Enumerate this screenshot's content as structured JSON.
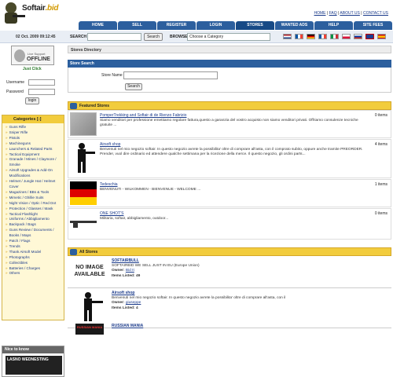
{
  "header": {
    "logo_prefix": "S",
    "logo_main": "oftair",
    "logo_suffix": ".bid",
    "toplinks": [
      "HOME",
      "FAQ",
      "ABOUT US",
      "CONTACT US"
    ],
    "nav": [
      "HOME",
      "SELL",
      "REGISTER",
      "LOGIN",
      "STORES",
      "WANTED ADS",
      "HELP",
      "SITE FEES"
    ],
    "active_nav": "STORES"
  },
  "infobar": {
    "date": "02 Oct. 2009 09:12:45",
    "search_label": "SEARCH",
    "search_button": "Search",
    "browse_label": "BROWSE",
    "browse_value": "Choose a Category",
    "flags": [
      "nl",
      "fr",
      "de",
      "fr2",
      "it",
      "pl",
      "ru",
      "gb",
      "es"
    ]
  },
  "sidebar": {
    "live_support": "Live Support",
    "offline": "OFFLINE",
    "just_click": "Just Click",
    "username_label": "Username",
    "password_label": "Password",
    "login_button": "login",
    "categories_title": "Categories [-]",
    "categories": [
      "Guns Rifle",
      "Sniper Rifle",
      "Pistols",
      "Machineguns",
      "Launchers & Related Parts",
      "Tactical Equipment",
      "Granade / Mines / Claymore / Smoke",
      "Airsoft Upgrades & Add-On Modifications",
      "Helmet / Jungle Hat / Helmet Cover",
      "Magazines / BBs & Tools",
      "Mimetic / Ghillie Suits",
      "Night Vision / Optic / Red Dot",
      "Protection / Glasses / Mask",
      "Tactical Flashlight",
      "Uniforms / Abbigliamento",
      "Backpack / Bags",
      "Guns Review / Documents / Books / Maps",
      "Patch / Flags",
      "Trends",
      "Thank Airsoft Model",
      "Photographs",
      "Collectibles",
      "Batteries / Charges",
      "Others"
    ],
    "nice_title": "Nice to know",
    "nice_banner": "LASNO WEDNESTING"
  },
  "main": {
    "directory_title": "Stores Directory",
    "store_search_title": "Store Search",
    "store_name_label": "Store Name",
    "search_button": "Search",
    "featured_title": "Featured Stores",
    "featured": [
      {
        "name": "PomperTrekking and Softair di de Rienzo Fabrizio",
        "items": "0 items",
        "desc": "Siamo venditori per professione emettiamo regolare fattura,questo a garanzia del vostro acquisto non siamo venditori privati. Offriamo consulenze tecniche gratuite ..."
      },
      {
        "name": "Airsoft shop",
        "items": "4 items",
        "desc": "Benvenuti nel mio negozio softair. In questo negozio avrete la possibilita' oltre di comprare all'asta, con il comprato subito, oppure anche tramite PREORDER. Prender, vuol dire ordinario ed attendere qualche settimana per la ricezione della merce. Il questo negozio, gli ordini parts..."
      },
      {
        "name": "Tedeschia",
        "items": "1 items",
        "desc": "BENVENUTI - WILKOMMEN - BIENVENUE - WELCOME ..."
      },
      {
        "name": "ONE SHOT'S",
        "items": "0 items",
        "desc": "Militaria, softair, abbigliamento, outdoor..."
      }
    ],
    "all_title": "All Stores",
    "all": [
      {
        "name": "SOFTAIRBULL",
        "thumb": "NO IMAGE AVAILABLE",
        "desc": "SOFTAIRBID WE SELL JUST IN EU (Europe Union)",
        "owner_label": "Owner:",
        "owner": "Bid It",
        "items_label": "Items Listed:",
        "items": "49"
      },
      {
        "name": "Airsoft shop",
        "thumb": "",
        "desc": "Benvenuti nel mio negozio softair. In questo negozio avrete la possibilita' oltre di comprare all'asta, con il",
        "owner_label": "Owner:",
        "owner": "giuseppe",
        "items_label": "Items Listed:",
        "items": "4"
      },
      {
        "name": "RUSSIAN MANIA",
        "thumb": "RUSSIAN MANIA",
        "desc": "",
        "owner_label": "",
        "owner": "",
        "items_label": "",
        "items": ""
      }
    ]
  },
  "colors": {
    "nav_blue": "#2c5f9e",
    "gold": "#f2cc3d",
    "link": "#1a3a8a"
  }
}
